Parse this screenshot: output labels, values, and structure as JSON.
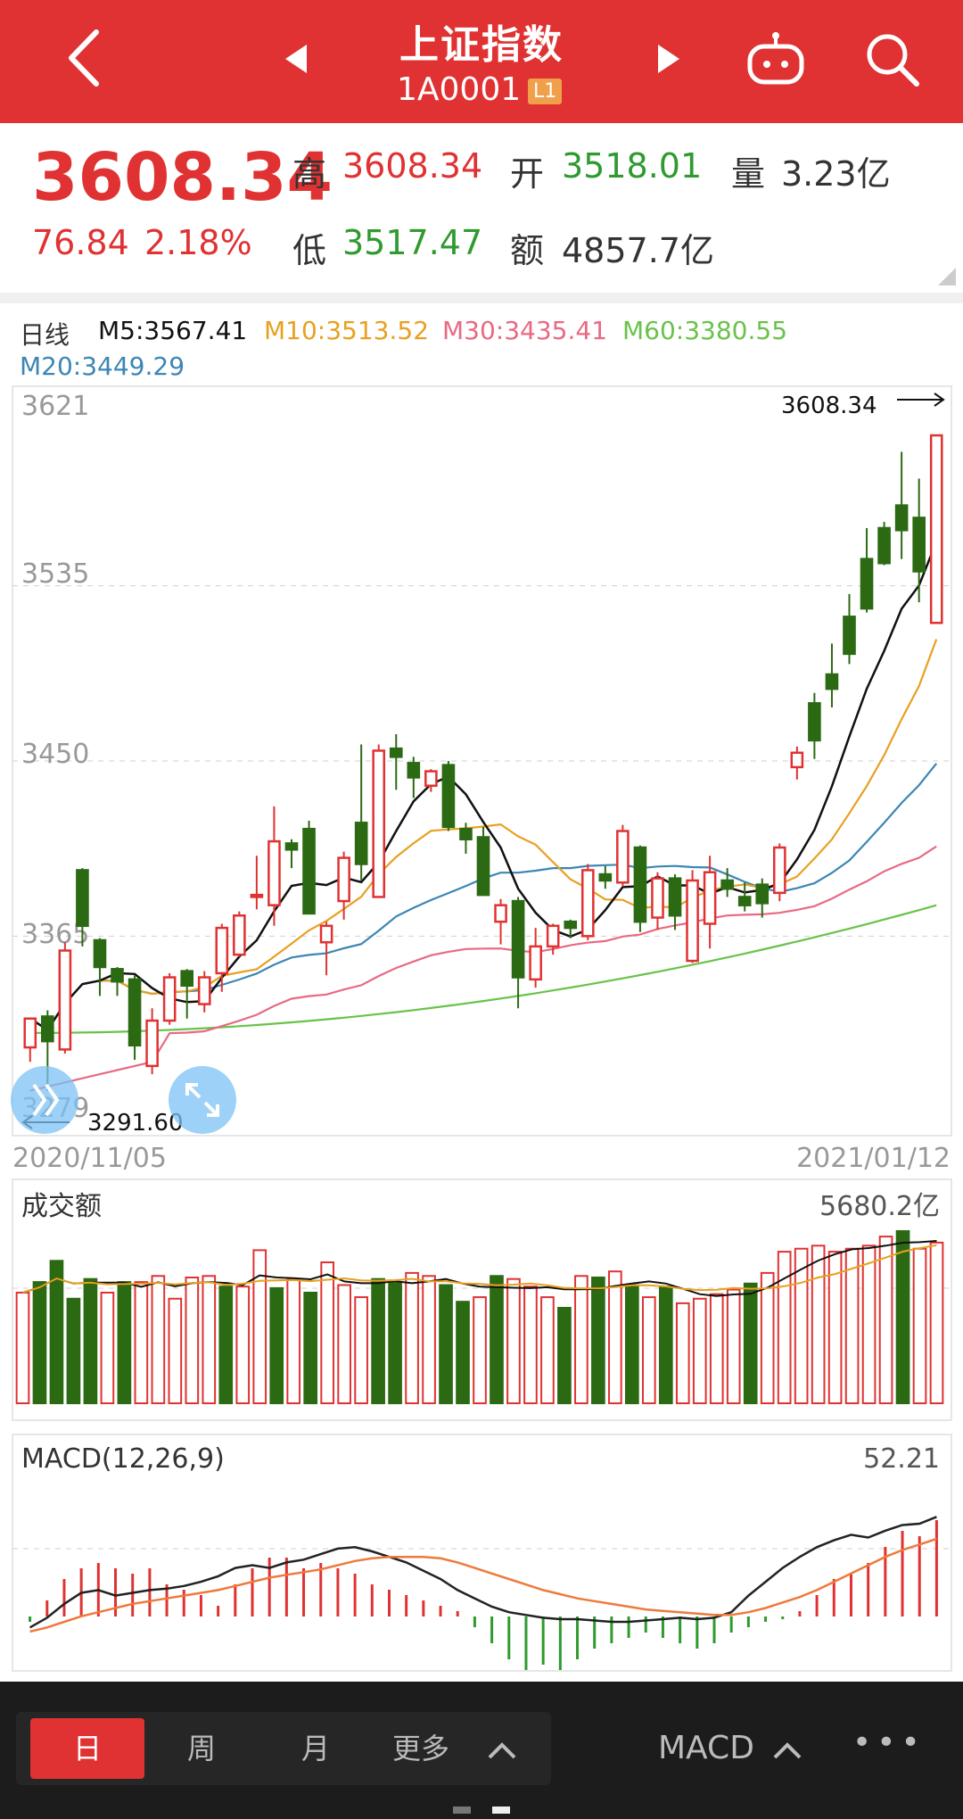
{
  "header": {
    "title": "上证指数",
    "code": "1A0001",
    "level_badge": "L1",
    "icons": [
      "back-arrow-icon",
      "prev-triangle-icon",
      "next-triangle-icon",
      "robot-icon",
      "search-icon"
    ]
  },
  "quote": {
    "price": "3608.34",
    "change": "76.84",
    "change_pct": "2.18%",
    "high_label": "高",
    "high": "3608.34",
    "open_label": "开",
    "open": "3518.01",
    "volume_label": "量",
    "volume": "3.23亿",
    "low_label": "低",
    "low": "3517.47",
    "amount_label": "额",
    "amount": "4857.7亿"
  },
  "ma_legend": {
    "period": "日线",
    "m5": "M5:3567.41",
    "m10": "M10:3513.52",
    "m30": "M30:3435.41",
    "m60": "M60:3380.55",
    "m20": "M20:3449.29"
  },
  "chart_data": [
    {
      "type": "candlestick",
      "y_ticks": [
        "3621",
        "3535",
        "3450",
        "3365",
        "3279"
      ],
      "ylim": [
        3279,
        3621
      ],
      "max_marker": "3608.34",
      "min_marker": "3291.60",
      "x_start": "2020/11/05",
      "x_end": "2021/01/12",
      "candles": [
        [
          3311,
          3325,
          3304,
          3325
        ],
        [
          3326,
          3314,
          3290,
          3329
        ],
        [
          3310,
          3358,
          3308,
          3362
        ],
        [
          3397,
          3370,
          3360,
          3398
        ],
        [
          3363,
          3350,
          3336,
          3364
        ],
        [
          3349,
          3343,
          3336,
          3350
        ],
        [
          3344,
          3312,
          3305,
          3346
        ],
        [
          3302,
          3324,
          3298,
          3330
        ],
        [
          3324,
          3345,
          3322,
          3347
        ],
        [
          3348,
          3341,
          3325,
          3349
        ],
        [
          3332,
          3345,
          3328,
          3348
        ],
        [
          3347,
          3369,
          3338,
          3371
        ],
        [
          3356,
          3375,
          3355,
          3377
        ],
        [
          3384,
          3385,
          3378,
          3404
        ],
        [
          3380,
          3411,
          3370,
          3428
        ],
        [
          3410,
          3407,
          3398,
          3412
        ],
        [
          3417,
          3376,
          3376,
          3421
        ],
        [
          3362,
          3370,
          3346,
          3372
        ],
        [
          3382,
          3403,
          3373,
          3406
        ],
        [
          3420,
          3400,
          3392,
          3458
        ],
        [
          3384,
          3455,
          3384,
          3458
        ],
        [
          3456,
          3452,
          3436,
          3463
        ],
        [
          3449,
          3442,
          3432,
          3452
        ],
        [
          3438,
          3445,
          3435,
          3446
        ],
        [
          3448,
          3418,
          3416,
          3450
        ],
        [
          3417,
          3412,
          3405,
          3420
        ],
        [
          3413,
          3385,
          3385,
          3418
        ],
        [
          3372,
          3380,
          3361,
          3383
        ],
        [
          3382,
          3345,
          3330,
          3384
        ],
        [
          3344,
          3360,
          3340,
          3369
        ],
        [
          3360,
          3370,
          3356,
          3371
        ],
        [
          3372,
          3369,
          3364,
          3373
        ],
        [
          3365,
          3397,
          3363,
          3400
        ],
        [
          3395,
          3392,
          3388,
          3399
        ],
        [
          3391,
          3416,
          3389,
          3419
        ],
        [
          3408,
          3372,
          3367,
          3409
        ],
        [
          3374,
          3393,
          3368,
          3396
        ],
        [
          3393,
          3375,
          3368,
          3395
        ],
        [
          3353,
          3392,
          3352,
          3397
        ],
        [
          3371,
          3396,
          3359,
          3404
        ],
        [
          3392,
          3388,
          3384,
          3398
        ],
        [
          3384,
          3380,
          3377,
          3391
        ],
        [
          3390,
          3381,
          3374,
          3393
        ],
        [
          3386,
          3408,
          3382,
          3410
        ],
        [
          3447,
          3454,
          3441,
          3457
        ],
        [
          3478,
          3460,
          3451,
          3483
        ],
        [
          3492,
          3485,
          3476,
          3507
        ],
        [
          3520,
          3502,
          3497,
          3531
        ],
        [
          3548,
          3524,
          3522,
          3563
        ],
        [
          3563,
          3546,
          3545,
          3566
        ],
        [
          3574,
          3562,
          3548,
          3600
        ],
        [
          3568,
          3542,
          3527,
          3587
        ],
        [
          3517,
          3608,
          3517,
          3608
        ]
      ],
      "series_colors": {
        "up": "#e03232",
        "down": "#2b6a13",
        "M5": "#111111",
        "M10": "#e8a020",
        "M20": "#3c86b4",
        "M30": "#e86a82",
        "M60": "#69c24a"
      }
    },
    {
      "type": "bar",
      "title": "成交额",
      "max_label": "5680.2亿",
      "values": [
        3650,
        4000,
        4700,
        3450,
        4100,
        3650,
        4000,
        4000,
        4200,
        3450,
        4150,
        4200,
        3850,
        3850,
        5050,
        3800,
        4100,
        3650,
        4650,
        3900,
        3500,
        4100,
        4000,
        4300,
        4200,
        3900,
        3350,
        3500,
        4200,
        4100,
        3850,
        3500,
        3150,
        4200,
        4150,
        4350,
        3900,
        3500,
        3850,
        3300,
        3450,
        3600,
        3750,
        3950,
        4300,
        5000,
        5100,
        5200,
        5000,
        5100,
        5200,
        5500,
        5680,
        5100,
        5300
      ],
      "up": [
        1,
        0,
        0,
        0,
        0,
        1,
        0,
        1,
        1,
        1,
        1,
        1,
        0,
        1,
        1,
        0,
        1,
        0,
        1,
        1,
        1,
        0,
        0,
        1,
        1,
        0,
        0,
        1,
        0,
        1,
        1,
        1,
        0,
        1,
        0,
        1,
        0,
        1,
        0,
        1,
        1,
        1,
        1,
        0,
        1,
        1,
        1,
        1,
        1,
        1,
        1,
        1,
        0,
        1
      ]
    },
    {
      "type": "bar",
      "title": "MACD(12,26,9)",
      "value_label": "52.21",
      "values": [
        -1,
        3,
        7,
        9,
        10,
        9,
        8,
        9,
        6,
        5,
        4,
        2,
        6,
        9,
        11,
        11,
        9,
        10,
        9,
        8,
        6,
        5,
        4,
        3,
        2,
        1,
        -2,
        -5,
        -8,
        -10,
        -9,
        -10,
        -8,
        -6,
        -5,
        -4,
        -3,
        -4,
        -5,
        -6,
        -5,
        -3,
        -2,
        -1,
        -0.5,
        1,
        4,
        7,
        8,
        10,
        13,
        16,
        15,
        18
      ],
      "line_macd": [
        5,
        12,
        22,
        30,
        32,
        28,
        30,
        32,
        33,
        35,
        38,
        42,
        48,
        50,
        48,
        52,
        54,
        58,
        62,
        63,
        60,
        56,
        52,
        46,
        40,
        32,
        26,
        20,
        16,
        14,
        12,
        11,
        11,
        10,
        9,
        9,
        10,
        11,
        12,
        11,
        12,
        16,
        28,
        38,
        48,
        56,
        63,
        68,
        72,
        70,
        75,
        79,
        80,
        85
      ],
      "line_signal": [
        2,
        5,
        9,
        13,
        16,
        19,
        22,
        24,
        26,
        28,
        30,
        32,
        35,
        38,
        41,
        43,
        45,
        47,
        50,
        53,
        55,
        56,
        56,
        56,
        55,
        52,
        48,
        44,
        40,
        36,
        32,
        29,
        26,
        24,
        22,
        20,
        18,
        17,
        16,
        15,
        14,
        14,
        16,
        19,
        23,
        27,
        32,
        38,
        44,
        50,
        56,
        61,
        65,
        69
      ]
    }
  ],
  "volume_panel": {
    "title": "成交额",
    "max": "5680.2亿"
  },
  "macd_panel": {
    "title": "MACD(12,26,9)",
    "value": "52.21"
  },
  "bottom_bar": {
    "tab_day": "日",
    "tab_week": "周",
    "tab_month": "月",
    "tab_more": "更多",
    "indicator": "MACD",
    "more_dots": "•••"
  }
}
